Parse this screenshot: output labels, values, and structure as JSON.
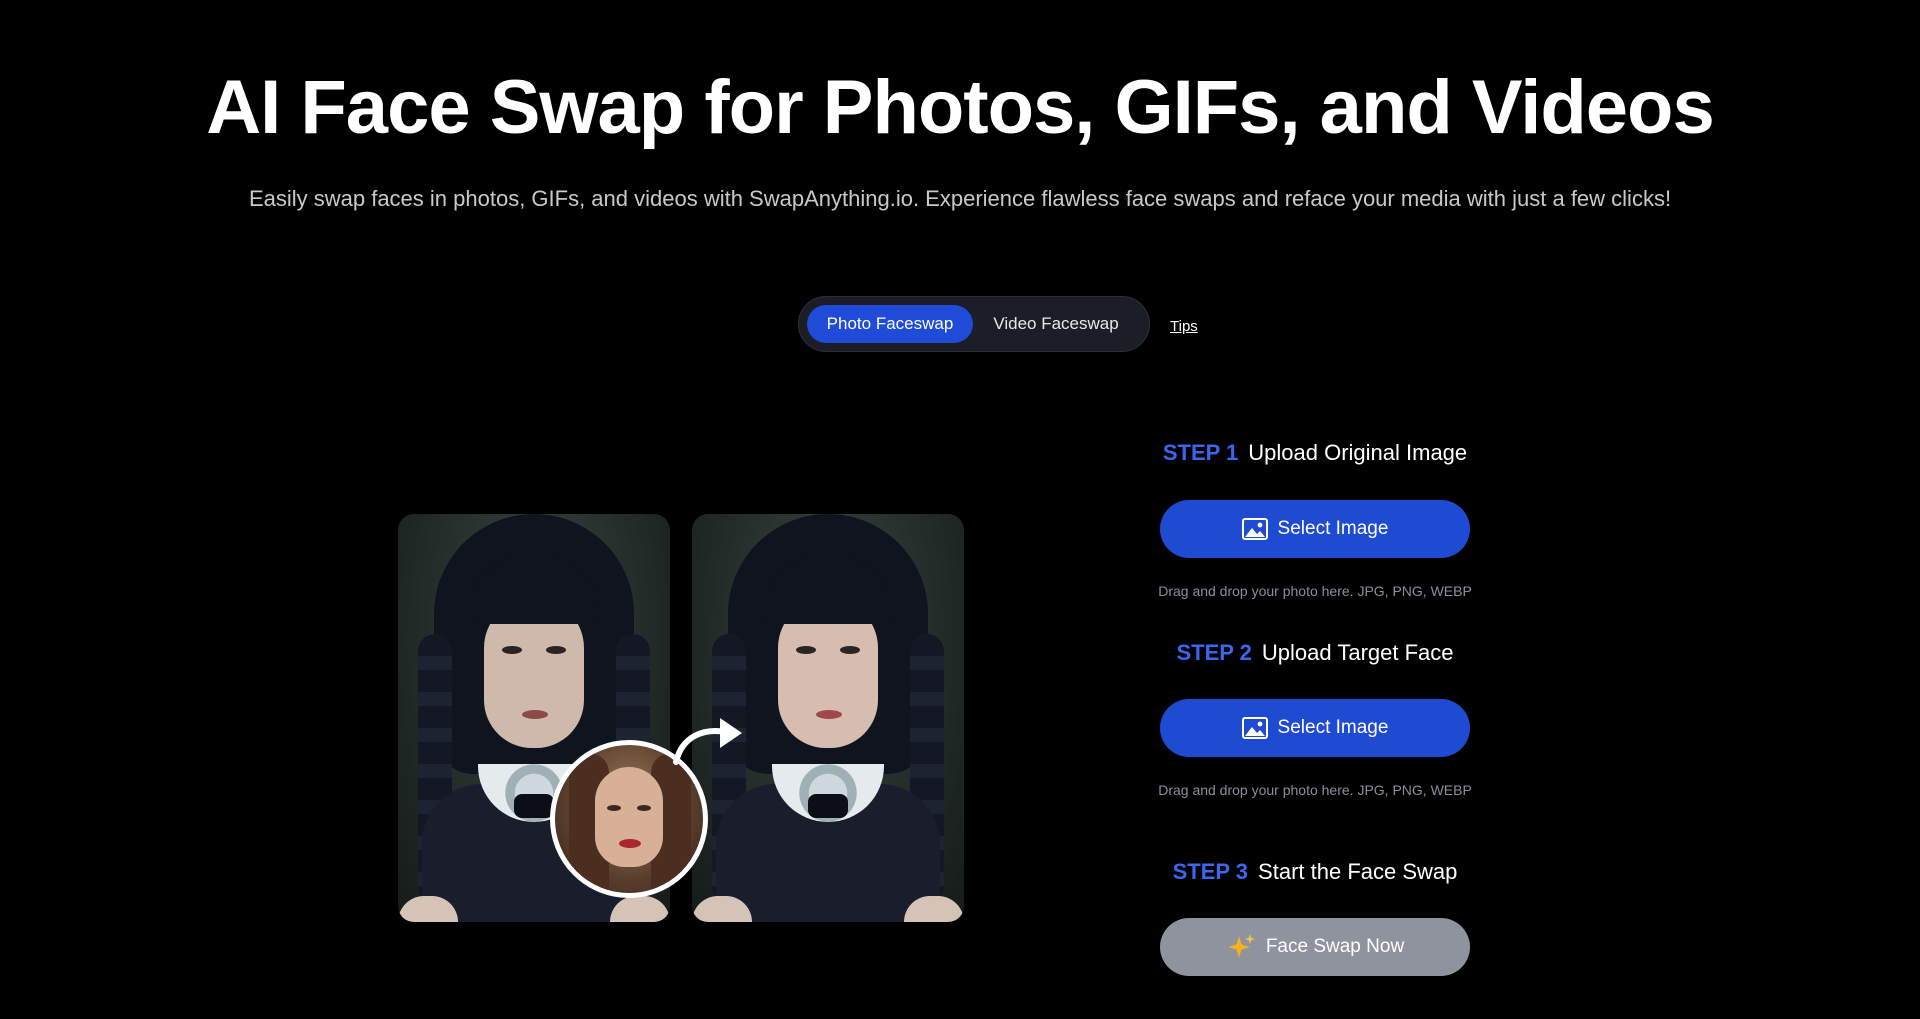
{
  "hero": {
    "title": "AI Face Swap for Photos, GIFs, and Videos",
    "subtitle": "Easily swap faces in photos, GIFs, and videos with SwapAnything.io. Experience flawless face swaps and reface your media with just a few clicks!"
  },
  "modes": {
    "tabs": [
      {
        "label": "Photo Faceswap",
        "active": true
      },
      {
        "label": "Video Faceswap",
        "active": false
      }
    ],
    "tips_label": "Tips"
  },
  "steps": [
    {
      "number": "STEP 1",
      "title": "Upload Original Image",
      "button": "Select Image",
      "icon": "image-icon",
      "hint": "Drag and drop your photo here. JPG, PNG, WEBP"
    },
    {
      "number": "STEP 2",
      "title": "Upload Target Face",
      "button": "Select Image",
      "icon": "image-icon",
      "hint": "Drag and drop your photo here. JPG, PNG, WEBP"
    },
    {
      "number": "STEP 3",
      "title": "Start the Face Swap",
      "button": "Face Swap Now",
      "icon": "sparkle-icon"
    }
  ],
  "colors": {
    "background": "#000000",
    "accent_blue": "#1e4bd2",
    "step_number": "#3a66f0",
    "disabled_button": "#8e939d",
    "sparkle": "#f5b21b"
  }
}
